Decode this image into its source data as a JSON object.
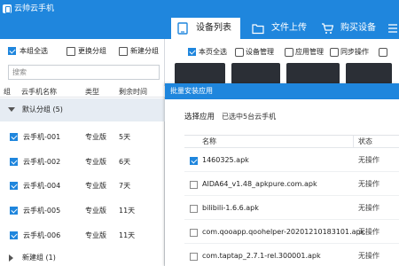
{
  "window": {
    "title": "云帅云手机"
  },
  "tabs": [
    {
      "label": "设备列表",
      "icon": "device-list-icon",
      "active": true
    },
    {
      "label": "文件上传",
      "icon": "upload-folder-icon",
      "active": false
    },
    {
      "label": "购买设备",
      "icon": "cart-icon",
      "active": false
    }
  ],
  "left_toolbar": {
    "select_all": "本组全选",
    "change_group": "更换分组",
    "new_group": "新建分组"
  },
  "search": {
    "placeholder": "搜索"
  },
  "device_table": {
    "headers": [
      "组",
      "云手机名称",
      "类型",
      "剩余时间"
    ],
    "group_name": "默认分组 (5)",
    "rows": [
      {
        "name": "云手机-001",
        "type": "专业版",
        "remaining": "5天"
      },
      {
        "name": "云手机-002",
        "type": "专业版",
        "remaining": "6天"
      },
      {
        "name": "云手机-004",
        "type": "专业版",
        "remaining": "7天"
      },
      {
        "name": "云手机-005",
        "type": "专业版",
        "remaining": "11天"
      },
      {
        "name": "云手机-006",
        "type": "专业版",
        "remaining": "11天"
      }
    ],
    "new_group_row": "新建组 (1)"
  },
  "right_toolbar": {
    "select_page": "本页全选",
    "device_manage": "设备管理",
    "app_manage": "应用管理",
    "sync_op": "同步操作"
  },
  "modal": {
    "title": "批量安装应用",
    "select_label": "选择应用",
    "selected_info": "已选中5台云手机",
    "col_name": "名称",
    "col_status": "状态",
    "apps": [
      {
        "name": "1460325.apk",
        "status": "无操作",
        "checked": true
      },
      {
        "name": "AIDA64_v1.48_apkpure.com.apk",
        "status": "无操作",
        "checked": false
      },
      {
        "name": "bilibili-1.6.6.apk",
        "status": "无操作",
        "checked": false
      },
      {
        "name": "com.qooapp.qoohelper-20201210183101.apk",
        "status": "无操作",
        "checked": false
      },
      {
        "name": "com.taptap_2.7.1-rel.300001.apk",
        "status": "无操作",
        "checked": false
      }
    ]
  },
  "colors": {
    "primary": "#1f86dd",
    "group_bg": "#e6ecf3"
  }
}
